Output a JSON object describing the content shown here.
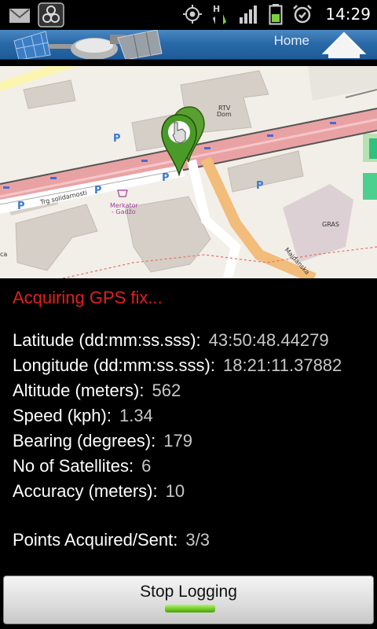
{
  "status_bar": {
    "time": "14:29",
    "icons": [
      "gmail-icon",
      "usb-debug-icon",
      "gps-icon",
      "network-hsdpa-icon",
      "signal-icon",
      "battery-icon",
      "alarm-icon"
    ],
    "network_type": "H"
  },
  "header": {
    "home_label": "Home"
  },
  "map": {
    "labels": {
      "rtv": "RTV\nDom",
      "trg": "Trg solidarnosti",
      "merkator": "Merkator\n- Gadžo",
      "gras": "GRAS",
      "majdanska": "Majdanska",
      "ca": "ca"
    },
    "parking_label": "P"
  },
  "status_message": "Acquiring GPS fix...",
  "fields": {
    "latitude": {
      "label": "Latitude (dd:mm:ss.sss):",
      "value": "43:50:48.44279"
    },
    "longitude": {
      "label": "Longitude (dd:mm:ss.sss):",
      "value": "18:21:11.37882"
    },
    "altitude": {
      "label": "Altitude (meters):",
      "value": "562"
    },
    "speed": {
      "label": "Speed (kph):",
      "value": "1.34"
    },
    "bearing": {
      "label": "Bearing (degrees):",
      "value": "179"
    },
    "satellites": {
      "label": "No of Satellites:",
      "value": "6"
    },
    "accuracy": {
      "label": "Accuracy (meters):",
      "value": "10"
    },
    "points": {
      "label": "Points Acquired/Sent:",
      "value": "3/3"
    }
  },
  "stop_button": {
    "label": "Stop Logging",
    "indicator_color": "#6cc81e"
  },
  "colors": {
    "status_message": "#e02020",
    "header_blue": "#2a6aa8"
  }
}
